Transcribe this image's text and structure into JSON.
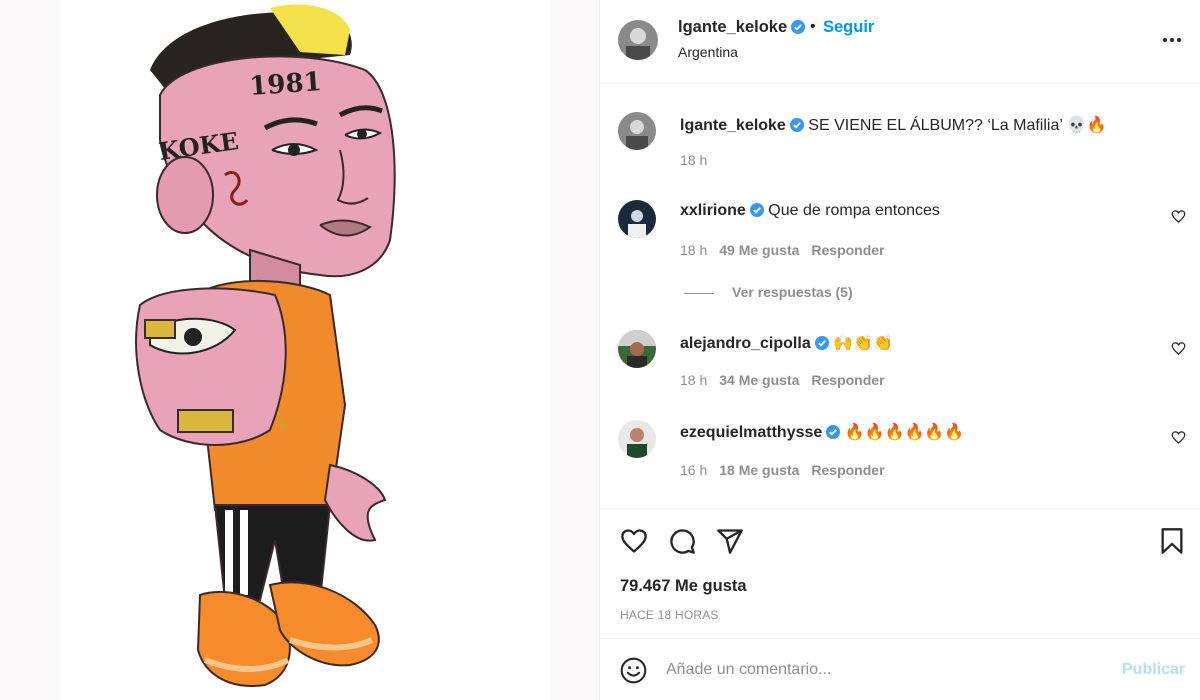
{
  "post": {
    "username": "lgante_keloke",
    "follow_label": "Seguir",
    "separator": "•",
    "location": "Argentina"
  },
  "caption": {
    "username": "lgante_keloke",
    "text": "SE VIENE EL ÁLBUM?? ‘La Mafilia’ 💀🔥",
    "time": "18 h"
  },
  "comments": [
    {
      "username": "xxlirione",
      "text": "Que de rompa entonces",
      "time": "18 h",
      "likes": "49 Me gusta",
      "reply_label": "Responder"
    },
    {
      "username": "alejandro_cipolla",
      "text": "🙌👏👏",
      "time": "18 h",
      "likes": "34 Me gusta",
      "reply_label": "Responder"
    },
    {
      "username": "ezequielmatthysse",
      "text": "🔥🔥🔥🔥🔥🔥",
      "time": "16 h",
      "likes": "18 Me gusta",
      "reply_label": "Responder"
    }
  ],
  "view_replies": "Ver respuestas (5)",
  "stats": {
    "likes": "79.467 Me gusta",
    "time_ago": "HACE 18 HORAS"
  },
  "comment_box": {
    "placeholder": "Añade un comentario...",
    "publish_label": "Publicar"
  },
  "icons": {
    "more": "more-options-icon",
    "like": "heart-icon",
    "comment": "comment-icon",
    "share": "share-icon",
    "save": "bookmark-icon",
    "emoji": "emoji-icon",
    "verified": "verified-badge-icon"
  },
  "colors": {
    "link": "#0095f6",
    "publish_disabled": "#b2dffc",
    "verified": "#3897f0",
    "muted": "#8e8e8e",
    "text": "#262626"
  }
}
